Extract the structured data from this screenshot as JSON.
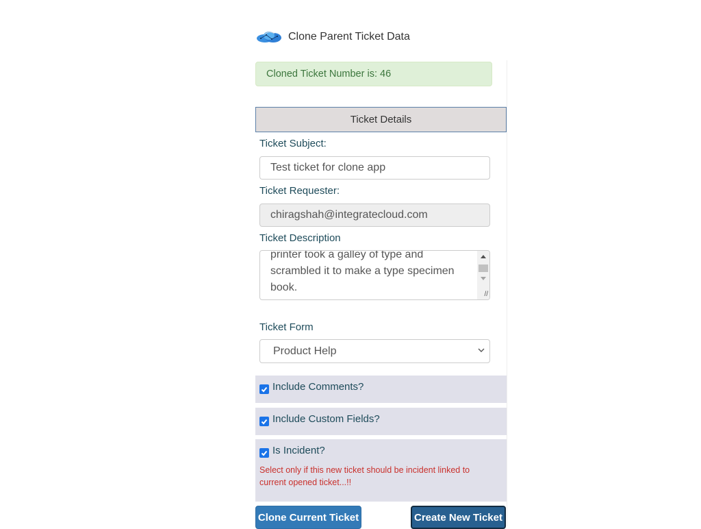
{
  "header": {
    "logo_icon": "cloud-network-icon",
    "title": "Clone Parent Ticket Data"
  },
  "alert": {
    "text": "Cloned Ticket Number is: 46",
    "color": "#3c763d",
    "background": "#dff0d8"
  },
  "section": {
    "title": "Ticket Details"
  },
  "form": {
    "subject_label": "Ticket Subject:",
    "subject_value": "Test ticket for clone app",
    "requester_label": "Ticket Requester:",
    "requester_value": "chiragshah@integratecloud.com",
    "description_label": "Ticket Description",
    "description_visible_lines": [
      "printer took a galley of type and",
      "scrambled it to make a type specimen",
      "book."
    ],
    "ticket_form_label": "Ticket Form",
    "ticket_form_selected": "Product Help"
  },
  "options": [
    {
      "label": "Include Comments?",
      "checked": true
    },
    {
      "label": "Include Custom Fields?",
      "checked": true
    },
    {
      "label": "Is Incident?",
      "checked": true
    }
  ],
  "incident_warning": "Select only if this new ticket should be incident linked to current opened ticket...!!",
  "buttons": {
    "clone": "Clone Current Ticket",
    "create": "Create New Ticket"
  },
  "colors": {
    "primary": "#337ab7",
    "primary_dark": "#286090",
    "warning_text": "#c9302c",
    "checkbox": "#1a73e8"
  }
}
